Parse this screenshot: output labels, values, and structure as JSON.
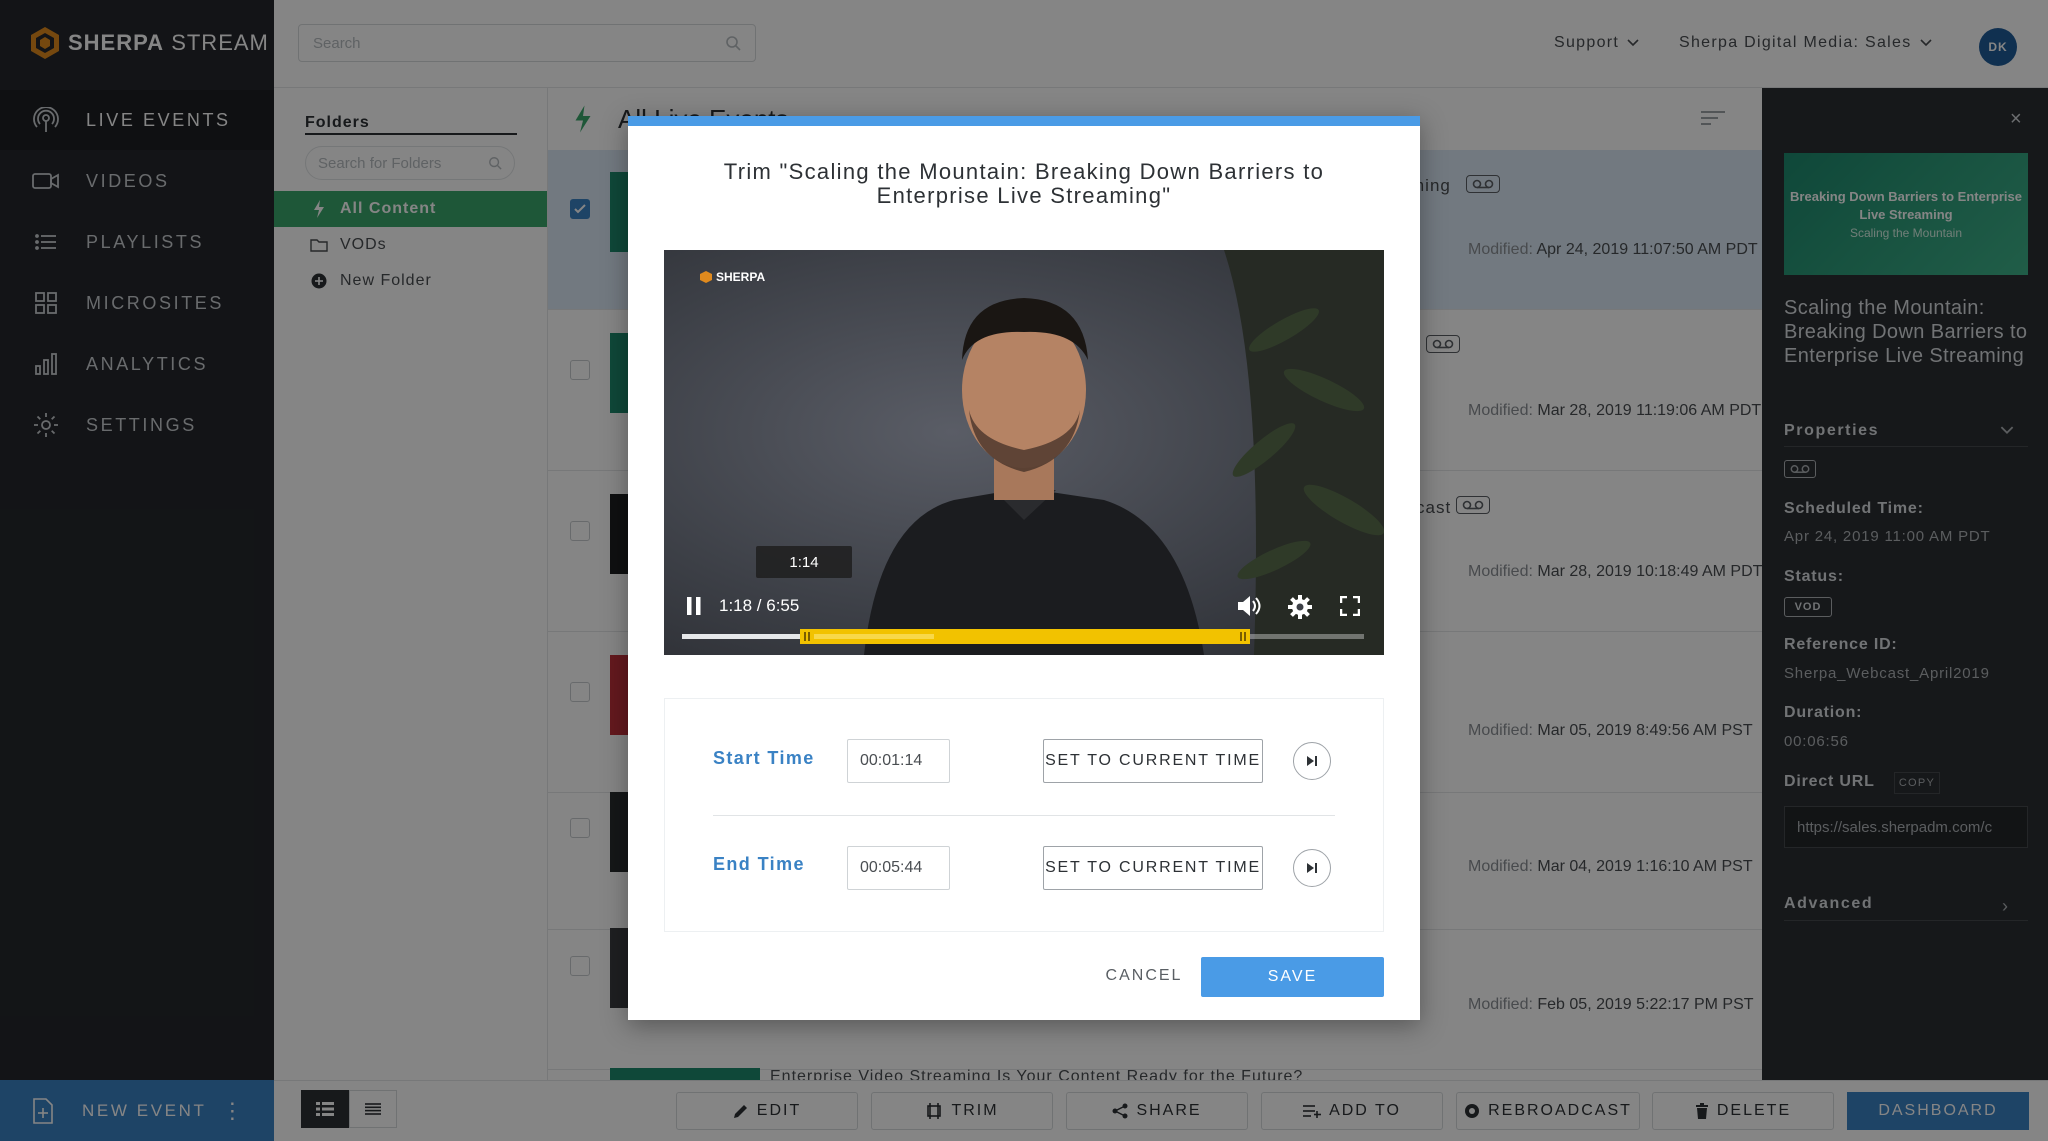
{
  "app": {
    "brand_bold": "SHERPA",
    "brand_light": "STREAM"
  },
  "sidebar": {
    "items": [
      {
        "label": "LIVE EVENTS",
        "icon": "broadcast-icon"
      },
      {
        "label": "VIDEOS",
        "icon": "video-camera-icon"
      },
      {
        "label": "PLAYLISTS",
        "icon": "list-icon"
      },
      {
        "label": "MICROSITES",
        "icon": "grid-icon"
      },
      {
        "label": "ANALYTICS",
        "icon": "bar-chart-icon"
      },
      {
        "label": "SETTINGS",
        "icon": "gear-icon"
      }
    ],
    "new_event_label": "NEW EVENT"
  },
  "topbar": {
    "search_placeholder": "Search",
    "support_label": "Support",
    "account_label": "Sherpa Digital Media: Sales",
    "avatar_initials": "DK"
  },
  "folders": {
    "title": "Folders",
    "search_placeholder": "Search for Folders",
    "items": [
      {
        "label": "All Content",
        "active": true
      },
      {
        "label": "VODs",
        "active": false
      },
      {
        "label": "New Folder",
        "active": false
      }
    ]
  },
  "content": {
    "title": "All Live Events",
    "rows": [
      {
        "title_fragment": "ming",
        "modified_prefix": "Modified:",
        "modified": "Apr 24, 2019 11:07:50 AM PDT",
        "selected": true,
        "thumb_color": "#1e8a6e"
      },
      {
        "title_fragment": "",
        "modified_prefix": "Modified:",
        "modified": "Mar 28, 2019 11:19:06 AM PDT",
        "selected": false,
        "thumb_color": "#1e8a6e"
      },
      {
        "title_fragment": "cast",
        "modified_prefix": "Modified:",
        "modified": "Mar 28, 2019 10:18:49 AM PDT",
        "selected": false,
        "thumb_color": "#1d1f22"
      },
      {
        "title_fragment": "",
        "modified_prefix": "Modified:",
        "modified": "Mar 05, 2019 8:49:56 AM PST",
        "selected": false,
        "thumb_color": "#c0303a"
      },
      {
        "title_fragment": "",
        "modified_prefix": "Modified:",
        "modified": "Mar 04, 2019 1:16:10 AM PST",
        "selected": false,
        "thumb_color": "#2a2c2f"
      },
      {
        "title_fragment": "",
        "modified_prefix": "Modified:",
        "modified": "Feb 05, 2019 5:22:17 PM PST",
        "selected": false,
        "thumb_color": "#3a3c40"
      }
    ],
    "last_row_title": "Enterprise Video Streaming Is Your Content Ready for the Future?"
  },
  "details": {
    "thumb_title": "Breaking Down Barriers to Enterprise Live Streaming",
    "thumb_subtitle": "Scaling the Mountain",
    "name": "Scaling the Mountain: Breaking Down Barriers to Enterprise Live Streaming",
    "properties_label": "Properties",
    "scheduled_label": "Scheduled Time:",
    "scheduled_value": "Apr 24, 2019 11:00 AM PDT",
    "status_label": "Status:",
    "status_value": "VOD",
    "reference_label": "Reference ID:",
    "reference_value": "Sherpa_Webcast_April2019",
    "duration_label": "Duration:",
    "duration_value": "00:06:56",
    "direct_url_label": "Direct URL",
    "copy_label": "COPY",
    "direct_url_value": "https://sales.sherpadm.com/c",
    "advanced_label": "Advanced"
  },
  "toolbar": {
    "edit": "EDIT",
    "trim": "TRIM",
    "share": "SHARE",
    "add_to": "ADD TO",
    "rebroadcast": "REBROADCAST",
    "delete": "DELETE",
    "dashboard": "DASHBOARD"
  },
  "modal": {
    "title": "Trim \"Scaling the Mountain: Breaking Down Barriers to Enterprise Live Streaming\"",
    "player": {
      "brand": "SHERPA",
      "hover_time": "1:14",
      "time_readout": "1:18 / 6:55",
      "played_fraction": 0.37,
      "trim_start_fraction": 0.178,
      "trim_end_fraction": 0.829
    },
    "start_label": "Start Time",
    "start_value": "00:01:14",
    "end_label": "End Time",
    "end_value": "00:05:44",
    "set_current_label": "SET TO CURRENT TIME",
    "cancel_label": "CANCEL",
    "save_label": "SAVE"
  }
}
